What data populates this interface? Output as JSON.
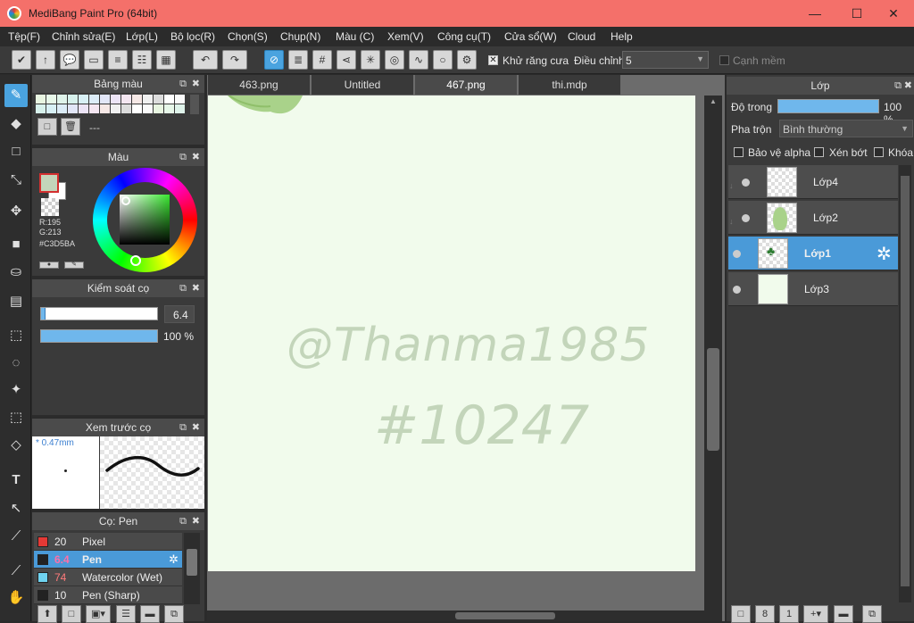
{
  "window": {
    "title": "MediBang Paint Pro (64bit)",
    "min": "—",
    "max": "☐",
    "close": "✕"
  },
  "menu": [
    "Tệp(F)",
    "Chỉnh sửa(E)",
    "Lớp(L)",
    "Bộ lọc(R)",
    "Chọn(S)",
    "Chụp(N)",
    "Màu (C)",
    "Xem(V)",
    "Công cụ(T)",
    "Cửa sổ(W)",
    "Cloud",
    "Help"
  ],
  "toolbar": {
    "antialias_label": "Khử răng cưa",
    "adjust_label": "Điều chỉnh",
    "adjust_value": "5",
    "soft_edge_label": "Cạnh mềm"
  },
  "palette_panel": {
    "title": "Bảng màu",
    "name": "---"
  },
  "color_panel": {
    "title": "Màu",
    "r": "R:195",
    "g": "G:213",
    "hex": "#C3D5BA",
    "fg": "#c3d5ba"
  },
  "brush_control": {
    "title": "Kiểm soát cọ",
    "size": "6.4",
    "opacity": "100 %",
    "size_fraction": 0.04,
    "opacity_fraction": 1.0
  },
  "brush_preview": {
    "title": "Xem trước cọ",
    "size_label": "* 0.47mm"
  },
  "brush_list": {
    "title": "Cọ: Pen",
    "items": [
      {
        "size": "20",
        "name": "Pixel",
        "color": "#e53935"
      },
      {
        "size": "6.4",
        "name": "Pen",
        "color": "#222222"
      },
      {
        "size": "74",
        "name": "Watercolor (Wet)",
        "color": "#6fd3f0"
      },
      {
        "size": "10",
        "name": "Pen (Sharp)",
        "color": "#222222"
      }
    ]
  },
  "tabs": [
    "463.png",
    "Untitled",
    "467.png",
    "thi.mdp"
  ],
  "canvas": {
    "line1": "@Thanma1985",
    "line2": "#10247"
  },
  "layer_panel": {
    "title": "Lớp",
    "opacity_label": "Độ trong",
    "opacity_value": "100 %",
    "blend_label": "Pha trộn",
    "blend_value": "Bình thường",
    "protect_alpha": "Bảo vệ alpha",
    "clipping": "Xén bớt",
    "lock": "Khóa",
    "layers": [
      {
        "name": "Lớp4"
      },
      {
        "name": "Lớp2"
      },
      {
        "name": "Lớp1"
      },
      {
        "name": "Lớp3"
      }
    ]
  }
}
